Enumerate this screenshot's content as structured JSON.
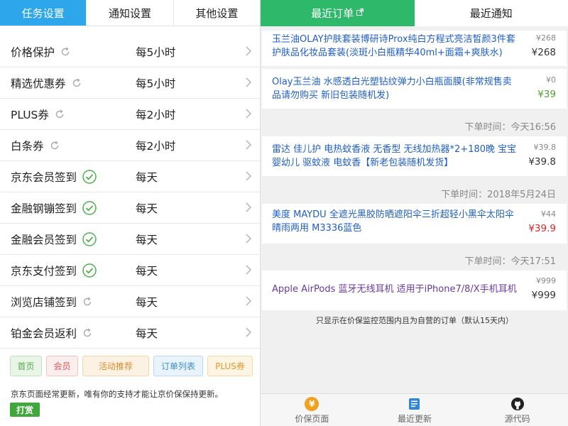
{
  "left": {
    "tabs": [
      "任务设置",
      "通知设置",
      "其他设置"
    ],
    "tasks": [
      {
        "name": "价格保护",
        "freq": "每5小时",
        "icon": "refresh-icon"
      },
      {
        "name": "精选优惠券",
        "freq": "每5小时",
        "icon": "refresh-icon"
      },
      {
        "name": "PLUS券",
        "freq": "每2小时",
        "icon": "refresh-icon"
      },
      {
        "name": "白条券",
        "freq": "每2小时",
        "icon": "refresh-icon"
      },
      {
        "name": "京东会员签到",
        "freq": "每天",
        "icon": "check-circle-icon"
      },
      {
        "name": "金融钢镚签到",
        "freq": "每天",
        "icon": "check-circle-icon"
      },
      {
        "name": "金融会员签到",
        "freq": "每天",
        "icon": "check-circle-icon"
      },
      {
        "name": "京东支付签到",
        "freq": "每天",
        "icon": "check-circle-icon"
      },
      {
        "name": "浏览店铺签到",
        "freq": "每天",
        "icon": "refresh-icon"
      },
      {
        "name": "铂金会员返利",
        "freq": "每天",
        "icon": "refresh-icon"
      }
    ],
    "buttons": [
      "首页",
      "会员",
      "活动推荐",
      "订单列表",
      "PLUS券"
    ],
    "note": "京东页面经常更新，唯有你的支持才能让京价保保持更新。",
    "tip_button": "打赏"
  },
  "right": {
    "tabs": [
      "最近订单",
      "最近通知"
    ],
    "orders": [
      {
        "title": "玉兰油OLAY护肤套装博研诗Prox纯白方程式亮洁皙颜3件套护肤品化妆品套装(淡斑小白瓶精华40ml+面霜+爽肤水)",
        "orig": "¥268",
        "price": "¥268",
        "price_color": "normal"
      },
      {
        "title": "Olay玉兰油 水感透白光塑钻纹弹力小白瓶面膜(非常规售卖品请勿购买 新旧包装随机发)",
        "orig": "¥0",
        "price": "¥39",
        "price_color": "green"
      },
      {
        "time_label": "下单时间：",
        "time": "今天16:56"
      },
      {
        "title": "雷达 佳儿护 电热蚊香液 无香型 无线加热器*2+180晚 宝宝婴幼儿 驱蚊液 电蚊香【新老包装随机发货】",
        "orig": "¥39.8",
        "price": "¥39.8",
        "price_color": "normal"
      },
      {
        "time_label": "下单时间：",
        "time": "2018年5月24日"
      },
      {
        "title": "美度 MAYDU 全遮光黑胶防晒遮阳伞三折超轻小黑伞太阳伞晴雨两用 M3336蓝色",
        "orig": "¥44",
        "price": "¥39.9",
        "price_color": "red"
      },
      {
        "time_label": "下单时间：",
        "time": "今天17:51"
      },
      {
        "title": "Apple AirPods 蓝牙无线耳机 适用于iPhone7/8/X手机耳机",
        "orig": "¥999",
        "price": "¥999",
        "price_color": "normal"
      }
    ],
    "footnote": "只显示在价保监控范围内且为自营的订单（默认15天内）",
    "nav": [
      {
        "label": "价保页面",
        "icon": "yen-coin-icon"
      },
      {
        "label": "最近更新",
        "icon": "news-icon"
      },
      {
        "label": "源代码",
        "icon": "github-icon"
      }
    ]
  },
  "colors": {
    "task_tab_active": "#2ea6ec",
    "order_tab_active": "#2eb86a",
    "link_blue": "#1f5ec9",
    "tip_green": "#3ea83a"
  }
}
